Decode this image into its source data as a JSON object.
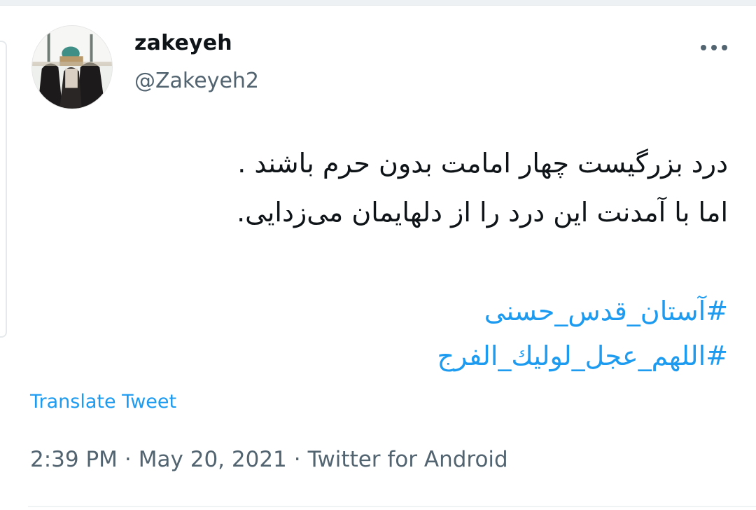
{
  "tweet": {
    "author": {
      "display_name": "zakeyeh",
      "handle": "@Zakeyeh2",
      "avatar_icon": "profile-photo"
    },
    "more_icon": "more-horizontal-icon",
    "text_lines": [
      "درد بزرگیست چهار امامت بدون حرم باشند .",
      "اما با آمدنت این درد را از دلهایمان می‌زدایی."
    ],
    "hashtags": [
      "#آستان_قدس_حسنی",
      "#اللهم_عجل_لوليك_الفرج"
    ],
    "translate_label": "Translate Tweet",
    "time": "2:39 PM",
    "date": "May 20, 2021",
    "separator": "·",
    "source": "Twitter for Android"
  },
  "colors": {
    "text": "#0f1419",
    "secondary_text": "#536471",
    "link": "#1d9bf0",
    "divider": "#eff3f4"
  }
}
